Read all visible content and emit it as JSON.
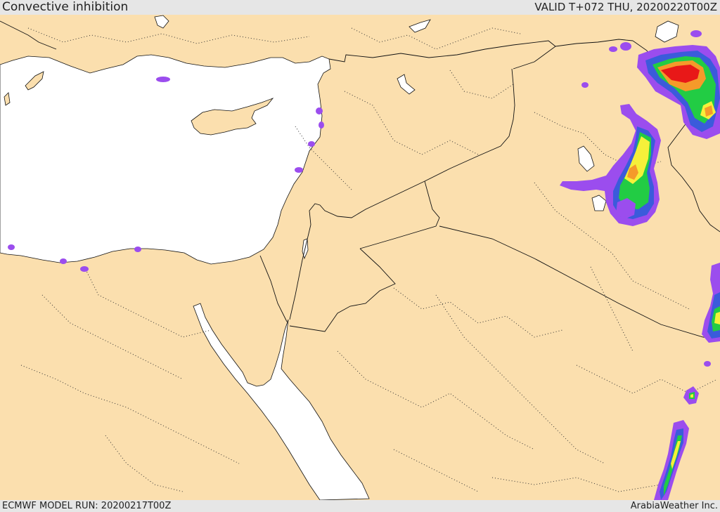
{
  "header": {
    "title": "Convective inhibition",
    "valid": "VALID T+072 THU, 20200220T00Z"
  },
  "footer": {
    "model_run": "ECMWF MODEL RUN: 20200217T00Z",
    "credit": "ArabiaWeather Inc."
  },
  "colors": {
    "land": "#fbdfae",
    "sea": "#ffffff",
    "bar": "#e6e6e6",
    "level_purple": "#9b4dee",
    "level_blue": "#3b5bdb",
    "level_green": "#22cc44",
    "level_yellow": "#f5f03a",
    "level_orange": "#f59a2a",
    "level_red": "#e81818"
  }
}
